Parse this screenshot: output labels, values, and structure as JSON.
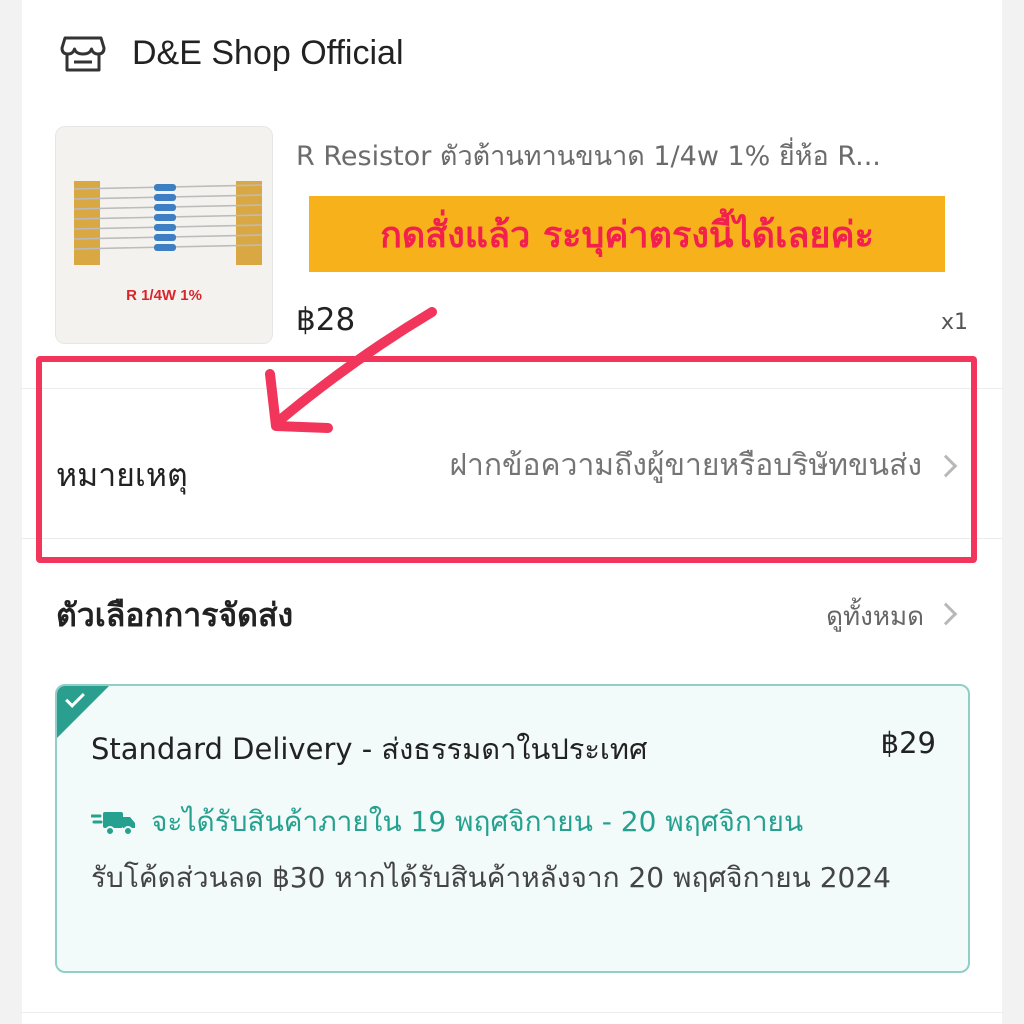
{
  "shop": {
    "name": "D&E Shop Official",
    "icon": "store-icon"
  },
  "product": {
    "title": "R Resistor ตัวต้านทานขนาด 1/4w 1% ยี่ห้อ R...",
    "thumb_label": "R 1/4W 1%",
    "promo_banner": "กดสั่งแล้ว ระบุค่าตรงนี้ได้เลยค่ะ",
    "price": "฿28",
    "quantity": "x1"
  },
  "note": {
    "label": "หมายเหตุ",
    "placeholder": "ฝากข้อความถึงผู้ขายหรือบริษัทขนส่ง"
  },
  "shipping": {
    "title": "ตัวเลือกการจัดส่ง",
    "view_all": "ดูทั้งหมด",
    "option": {
      "name": "Standard Delivery - ส่งธรรมดาในประเทศ",
      "price": "฿29",
      "eta": "จะได้รับสินค้าภายใน 19 พฤศจิกายน - 20 พฤศจิกายน",
      "voucher": "รับโค้ดส่วนลด ฿30 หากได้รับสินค้าหลังจาก 20 พฤศจิกายน 2024",
      "selected": true
    }
  },
  "colors": {
    "highlight": "#f2365b",
    "banner_bg": "#f7b21b",
    "banner_text": "#f2204f",
    "teal": "#26a08f"
  }
}
